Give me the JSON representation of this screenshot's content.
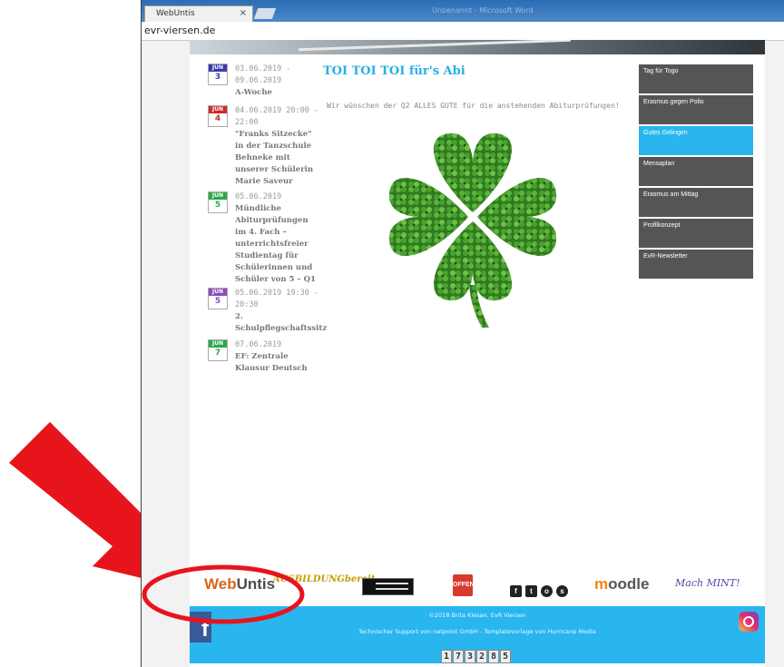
{
  "browser": {
    "tab_title": "WebUntis",
    "tab_close": "×",
    "window_title": "Unbenannt - Microsoft Word",
    "address": "evr-viersen.de"
  },
  "events": [
    {
      "month": "JUN",
      "day": "3",
      "month_color": "#3b3bb0",
      "date": "03.06.2019 - 09.06.2019",
      "title": "A-Woche"
    },
    {
      "month": "JUN",
      "day": "4",
      "month_color": "#cc2b2b",
      "date": "04.06.2019 20:00 - 22:00",
      "title": "\"Franks Sitzecke\" in der Tanzschule Behneke mit unserer Schülerin Marie Saveur"
    },
    {
      "month": "JUN",
      "day": "5",
      "month_color": "#2ea84a",
      "date": "05.06.2019",
      "title": "Mündliche Abiturprüfungen im 4. Fach – unterrichtsfreier Studientag für Schülerinnen und Schüler von 5 – Q1"
    },
    {
      "month": "JUN",
      "day": "5",
      "month_color": "#8e4cc0",
      "date": "05.06.2019 19:30 - 20:30",
      "title": "2. Schulpflegschaftssitz"
    },
    {
      "month": "JUN",
      "day": "7",
      "month_color": "#2ea84a",
      "date": "07.06.2019",
      "title": "EF: Zentrale Klausur Deutsch"
    }
  ],
  "article": {
    "headline": "TOI TOI TOI für's Abi",
    "text": "Wir wünschen der Q2 ALLES GUTE für die anstehenden Abiturprüfungen!"
  },
  "nav": [
    {
      "label": "Tag für Togo",
      "active": false
    },
    {
      "label": "Erasmus gegen Polio",
      "active": false
    },
    {
      "label": "Gutes Gelingen",
      "active": true
    },
    {
      "label": "Mensaplan",
      "active": false
    },
    {
      "label": "Erasmus am Mittag",
      "active": false
    },
    {
      "label": "Profilkonzept",
      "active": false
    },
    {
      "label": "EvR-Newsletter",
      "active": false
    }
  ],
  "logos": {
    "webuntis_a": "Web",
    "webuntis_b": "Untis",
    "ausbildung": "AUSBILDUNGbereit",
    "offen": "OFFEN",
    "moodle_m": "m",
    "moodle_rest": "oodle",
    "mach": "Mach MINT!"
  },
  "footer": {
    "copyright": "©2018 Brita Kiesan, EvR Viersen",
    "support": "Technischer Support von netpoint GmbH - Templatevorlage von Hurricane Media",
    "counter": [
      "1",
      "7",
      "3",
      "2",
      "8",
      "5"
    ]
  },
  "colors": {
    "accent": "#29b6ef",
    "nav_bg": "#555555",
    "annotation": "#e8141b"
  }
}
